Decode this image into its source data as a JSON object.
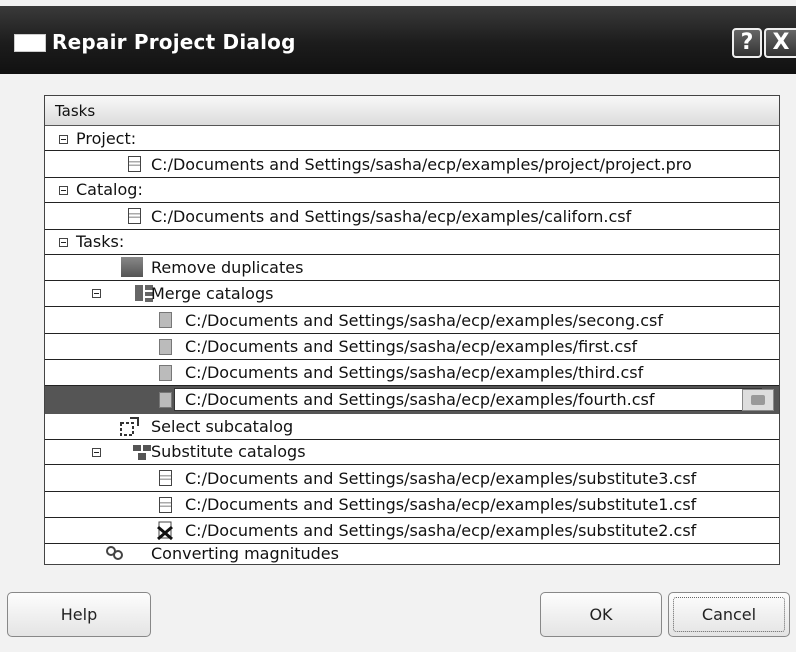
{
  "window": {
    "title": "Repair Project Dialog",
    "help_glyph": "?",
    "close_glyph": "X"
  },
  "tree": {
    "column_header": "Tasks",
    "project_label": "Project:",
    "project_file": "C:/Documents and Settings/sasha/ecp/examples/project/project.pro",
    "catalog_label": "Catalog:",
    "catalog_file": "C:/Documents and Settings/sasha/ecp/examples/californ.csf",
    "tasks_label": "Tasks:",
    "remove_duplicates": "Remove duplicates",
    "merge_catalogs": "Merge catalogs",
    "merge_files": [
      "C:/Documents and Settings/sasha/ecp/examples/secong.csf",
      "C:/Documents and Settings/sasha/ecp/examples/first.csf",
      "C:/Documents and Settings/sasha/ecp/examples/third.csf",
      "C:/Documents and Settings/sasha/ecp/examples/fourth.csf"
    ],
    "select_subcatalog": "Select subcatalog",
    "substitute_catalogs": "Substitute catalogs",
    "substitute_files": [
      "C:/Documents and Settings/sasha/ecp/examples/substitute3.csf",
      "C:/Documents and Settings/sasha/ecp/examples/substitute1.csf",
      "C:/Documents and Settings/sasha/ecp/examples/substitute2.csf"
    ],
    "converting_magnitudes": "Converting magnitudes"
  },
  "buttons": {
    "help": "Help",
    "ok": "OK",
    "cancel": "Cancel"
  }
}
